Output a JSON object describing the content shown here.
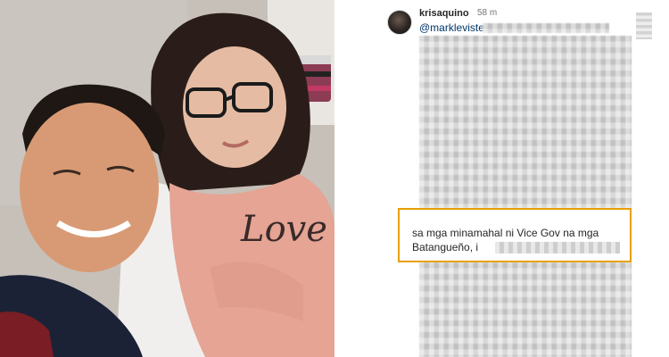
{
  "photo": {
    "shirt_text": "Love"
  },
  "comment": {
    "username": "krisaquino",
    "time": "58 m",
    "mention": "@markleviste",
    "highlight_line1": "sa mga minamahal ni Vice Gov na mga",
    "highlight_line2": "Batangueño, i"
  },
  "colors": {
    "highlight_border": "#e8a000",
    "mention_link": "#00376b",
    "blur_gray": "#d4d4d4"
  }
}
